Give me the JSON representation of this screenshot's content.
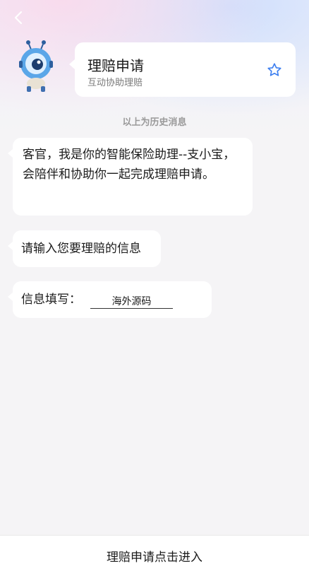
{
  "header": {
    "title": "理赔申请",
    "subtitle": "互动协助理赔"
  },
  "icons": {
    "back": "chevron-left-icon",
    "favorite": "star-outline-icon",
    "mascot": "assistant-robot-avatar"
  },
  "colors": {
    "accent": "#3d7ff0",
    "bubble": "#ffffff",
    "background": "#f5f4f6"
  },
  "chat": {
    "history_divider": "以上为历史消息",
    "messages": [
      {
        "text": "客官，我是你的智能保险助理--支小宝，会陪伴和协助你一起完成理赔申请。"
      },
      {
        "text": "请输入您要理赔的信息"
      }
    ],
    "form": {
      "label": "信息填写：",
      "value": "海外源码"
    }
  },
  "footer": {
    "action_label": "理赔申请点击进入"
  }
}
